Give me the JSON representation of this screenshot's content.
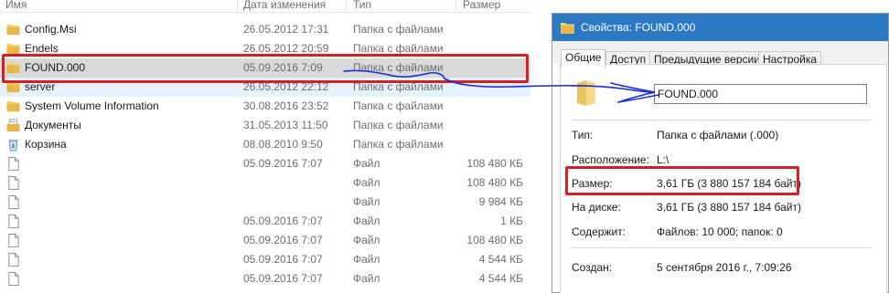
{
  "explorer": {
    "columns": {
      "name": "Имя",
      "date": "Дата изменения",
      "type": "Тип",
      "size": "Размер"
    },
    "rows": [
      {
        "icon": "folder-icon",
        "name": "Config.Msi",
        "date": "26.05.2012 17:31",
        "type": "Папка с файлами",
        "size": ""
      },
      {
        "icon": "folder-icon",
        "name": "Endels",
        "date": "26.05.2012 20:59",
        "type": "Папка с файлами",
        "size": ""
      },
      {
        "icon": "folder-icon",
        "name": "FOUND.000",
        "date": "05.09.2016 7:09",
        "type": "Папка с файлами",
        "size": ""
      },
      {
        "icon": "folder-icon",
        "name": "server",
        "date": "26.05.2012 22:12",
        "type": "Папка с файлами",
        "size": ""
      },
      {
        "icon": "folder-icon",
        "name": "System Volume Information",
        "date": "30.08.2016 23:52",
        "type": "Папка с файлами",
        "size": ""
      },
      {
        "icon": "documents-icon",
        "name": "Документы",
        "date": "31.05.2013 11:50",
        "type": "Папка с файлами",
        "size": ""
      },
      {
        "icon": "recycle-bin-icon",
        "name": "Корзина",
        "date": "08.08.2010 9:50",
        "type": "Папка с файлами",
        "size": ""
      },
      {
        "icon": "file-icon",
        "name": "",
        "date": "05.09.2016 7:07",
        "type": "Файл",
        "size": "108 480 КБ"
      },
      {
        "icon": "file-icon",
        "name": "",
        "date": "",
        "type": "Файл",
        "size": "108 480 КБ"
      },
      {
        "icon": "file-icon",
        "name": "",
        "date": "",
        "type": "Файл",
        "size": "9 984 КБ"
      },
      {
        "icon": "file-icon",
        "name": "",
        "date": "05.09.2016 7:07",
        "type": "Файл",
        "size": "1 КБ"
      },
      {
        "icon": "file-icon",
        "name": "",
        "date": "05.09.2016 7:07",
        "type": "Файл",
        "size": "108 480 КБ"
      },
      {
        "icon": "file-icon",
        "name": "",
        "date": "05.09.2016 7:07",
        "type": "Файл",
        "size": "4 544 КБ"
      },
      {
        "icon": "file-icon",
        "name": "",
        "date": "05.09.2016 7:07",
        "type": "Файл",
        "size": "4 544 КБ"
      }
    ]
  },
  "properties": {
    "title": "Свойства: FOUND.000",
    "tabs": [
      "Общие",
      "Доступ",
      "Предыдущие версии",
      "Настройка"
    ],
    "active_tab": "Общие",
    "name_value": "FOUND.000",
    "fields": [
      {
        "label": "Тип:",
        "value": "Папка с файлами (.000)"
      },
      {
        "label": "Расположение:",
        "value": "L:\\"
      },
      {
        "label": "Размер:",
        "value": "3,61 ГБ (3 880 157 184 байт)"
      },
      {
        "label": "На диске:",
        "value": "3,61 ГБ (3 880 157 184 байт)"
      },
      {
        "label": "Содержит:",
        "value": "Файлов: 10 000; папок: 0"
      },
      {
        "label": "Создан:",
        "value": "5 сентября 2016 г., 7:09:26"
      }
    ]
  },
  "colors": {
    "titlebar": "#2b78c4",
    "highlight_box": "#d32020",
    "pen_arrow": "#1a2ad8",
    "folder": "#e8c25a"
  }
}
